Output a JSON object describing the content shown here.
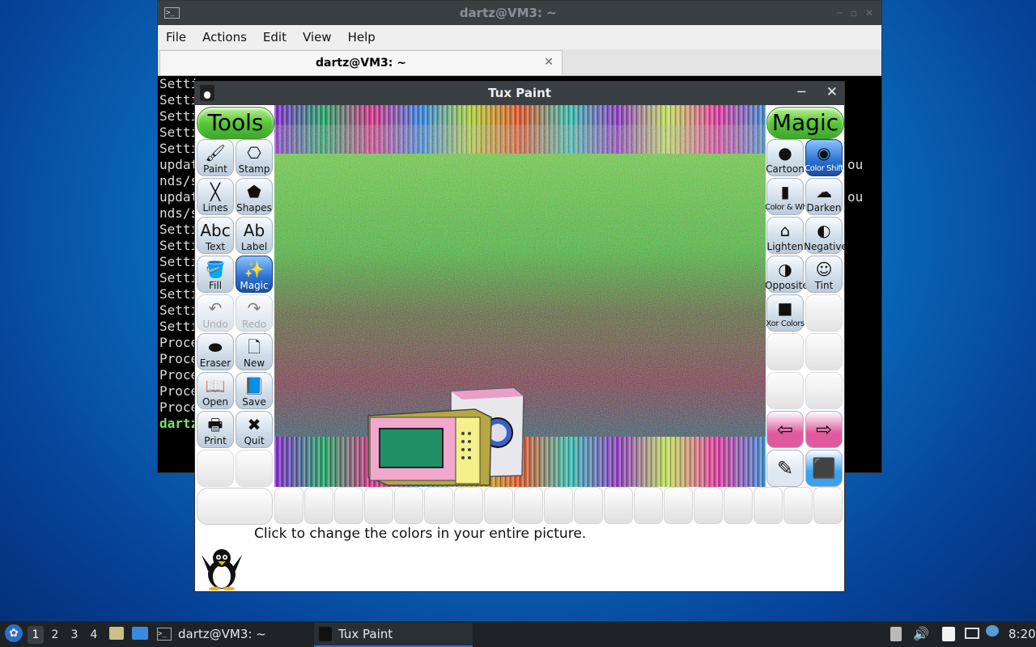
{
  "terminal": {
    "title": "dartz@VM3: ~",
    "menu": [
      "File",
      "Actions",
      "Edit",
      "View",
      "Help"
    ],
    "tab_label": "dartz@VM3: ~",
    "lines": [
      "Setti",
      "Setti",
      "Setti",
      "Setti",
      "Setti",
      "updat",
      "nds/s",
      "updat",
      "nds/s",
      "Setti",
      "Setti",
      "Setti",
      "Setti",
      "Setti",
      "Setti",
      "Setti",
      "Proce",
      "Proce",
      "Proce",
      "Proce",
      "Proce",
      "dartz"
    ],
    "right_fragments": [
      "ou",
      "ou"
    ]
  },
  "tuxpaint": {
    "title": "Tux Paint",
    "tools_header": "Tools",
    "magic_header": "Magic",
    "tools": [
      {
        "label": "Paint",
        "icon": "paintbrush-icon",
        "glyph": "🖌"
      },
      {
        "label": "Stamp",
        "icon": "stamp-icon",
        "glyph": "⎔"
      },
      {
        "label": "Lines",
        "icon": "lines-icon",
        "glyph": "╳"
      },
      {
        "label": "Shapes",
        "icon": "shapes-icon",
        "glyph": "⬟"
      },
      {
        "label": "Text",
        "icon": "text-icon",
        "glyph": "Abc"
      },
      {
        "label": "Label",
        "icon": "label-icon",
        "glyph": "Ab"
      },
      {
        "label": "Fill",
        "icon": "fill-bucket-icon",
        "glyph": "🪣"
      },
      {
        "label": "Magic",
        "icon": "magic-wand-icon",
        "glyph": "✨",
        "selected": true
      },
      {
        "label": "Undo",
        "icon": "undo-icon",
        "glyph": "↶",
        "disabled": true
      },
      {
        "label": "Redo",
        "icon": "redo-icon",
        "glyph": "↷",
        "disabled": true
      },
      {
        "label": "Eraser",
        "icon": "eraser-icon",
        "glyph": "⬬"
      },
      {
        "label": "New",
        "icon": "new-page-icon",
        "glyph": "🗋"
      },
      {
        "label": "Open",
        "icon": "open-book-icon",
        "glyph": "📖"
      },
      {
        "label": "Save",
        "icon": "save-book-icon",
        "glyph": "📘"
      },
      {
        "label": "Print",
        "icon": "printer-icon",
        "glyph": "🖶"
      },
      {
        "label": "Quit",
        "icon": "quit-icon",
        "glyph": "✖"
      }
    ],
    "magic_tools": [
      {
        "label": "Cartoon",
        "icon": "cartoon-icon",
        "glyph": "●"
      },
      {
        "label": "Color Shift",
        "icon": "color-shift-icon",
        "glyph": "◉",
        "selected": true,
        "small": true
      },
      {
        "label": "Color & White",
        "icon": "color-and-white-icon",
        "glyph": "▮",
        "small": true
      },
      {
        "label": "Darken",
        "icon": "darken-icon",
        "glyph": "☁"
      },
      {
        "label": "Lighten",
        "icon": "lighten-icon",
        "glyph": "⌂"
      },
      {
        "label": "Negative",
        "icon": "negative-icon",
        "glyph": "◐"
      },
      {
        "label": "Opposite",
        "icon": "opposite-icon",
        "glyph": "◑"
      },
      {
        "label": "Tint",
        "icon": "tint-icon",
        "glyph": "☺"
      },
      {
        "label": "Xor Colors",
        "icon": "xor-colors-icon",
        "glyph": "■",
        "small": true
      }
    ],
    "message": "Click to change the colors in your entire picture."
  },
  "taskbar": {
    "workspaces": [
      "1",
      "2",
      "3",
      "4"
    ],
    "tasks": [
      {
        "label": "dartz@VM3: ~"
      },
      {
        "label": "Tux Paint"
      }
    ],
    "clock": "8:20"
  }
}
